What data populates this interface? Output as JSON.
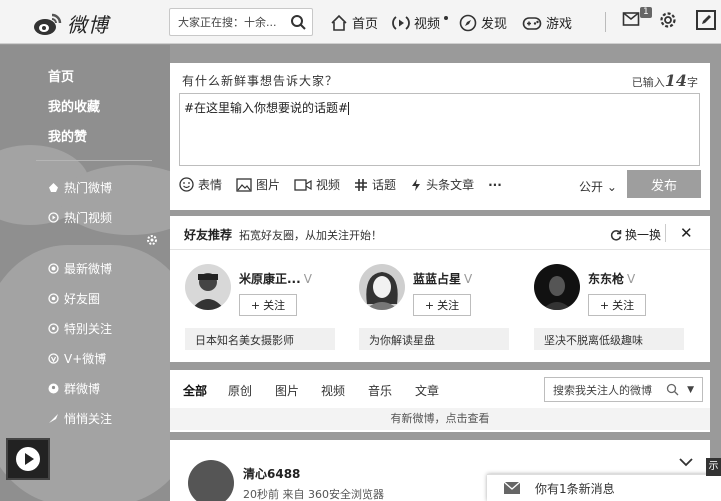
{
  "header": {
    "logo_text": "微博",
    "search_placeholder": "大家正在搜：十余...",
    "nav": [
      {
        "label": "首页",
        "icon": "home-icon"
      },
      {
        "label": "视频",
        "icon": "video-play-icon"
      },
      {
        "label": "发现",
        "icon": "compass-icon"
      },
      {
        "label": "游戏",
        "icon": "gamepad-icon"
      }
    ],
    "message_badge": "1"
  },
  "sidebar": {
    "top_items": [
      "首页",
      "我的收藏",
      "我的赞"
    ],
    "mid_items": [
      {
        "label": "热门微博",
        "icon": "flame-icon"
      },
      {
        "label": "热门视频",
        "icon": "video-icon"
      }
    ],
    "group_items": [
      {
        "label": "最新微博",
        "icon": "circle-dot-icon"
      },
      {
        "label": "好友圈",
        "icon": "heart-circle-icon"
      },
      {
        "label": "特别关注",
        "icon": "star-circle-icon"
      },
      {
        "label": "V+微博",
        "icon": "vplus-icon"
      },
      {
        "label": "群微博",
        "icon": "group-icon"
      },
      {
        "label": "悄悄关注",
        "icon": "quill-icon"
      }
    ]
  },
  "compose": {
    "prompt": "有什么新鲜事想告诉大家？",
    "count_prefix": "已输入",
    "count_value": "14",
    "count_suffix": "字",
    "text": "#在这里输入你想要说的话题#",
    "tools": [
      "表情",
      "图片",
      "视频",
      "话题",
      "头条文章",
      "···"
    ],
    "visibility": "公开",
    "post_label": "发布"
  },
  "friends": {
    "title": "好友推荐",
    "subtitle": "拓宽好友圈，从加关注开始！",
    "refresh_label": "换一换",
    "follow_label": "关注",
    "people": [
      {
        "name": "米原康正...",
        "desc": "日本知名美女摄影师"
      },
      {
        "name": "蓝蓝占星",
        "desc": "为你解读星盘"
      },
      {
        "name": "东东枪",
        "desc": "坚决不脱离低级趣味"
      }
    ]
  },
  "feed": {
    "tabs": [
      "全部",
      "原创",
      "图片",
      "视频",
      "音乐",
      "文章"
    ],
    "search_placeholder": "搜索我关注人的微博",
    "new_notice": "有新微博，点击查看"
  },
  "post": {
    "author": "清心6488",
    "meta": "20秒前 来自 360安全浏览器"
  },
  "popup": {
    "message": "你有1条新消息",
    "corner_char": "示"
  }
}
